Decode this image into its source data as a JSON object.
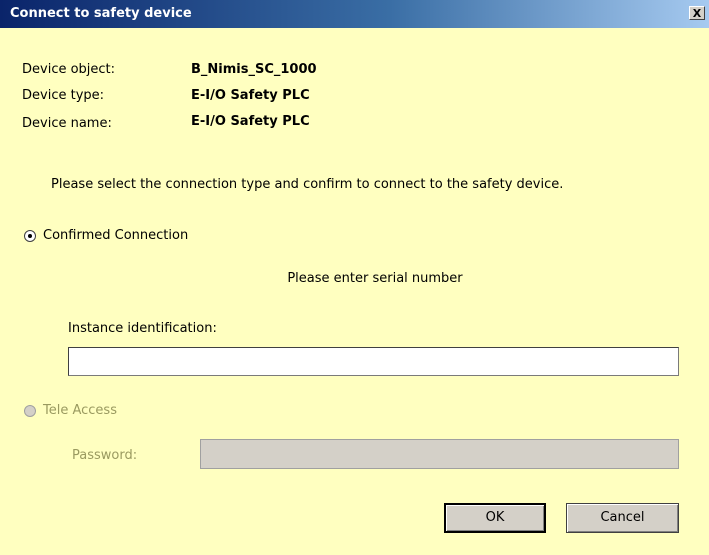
{
  "window": {
    "title": "Connect to safety device",
    "close_label": "X"
  },
  "device_info": {
    "object_label": "Device object:",
    "object_value": "B_Nimis_SC_1000",
    "type_label": "Device type:",
    "type_value": "E-I/O Safety PLC",
    "name_label": "Device name:",
    "name_value": "E-I/O Safety PLC"
  },
  "instruction": "Please select the connection type and confirm to connect to the safety device.",
  "confirmed": {
    "label": "Confirmed Connection",
    "selected": true,
    "note": "Please enter serial number",
    "instance_label": "Instance identification:",
    "instance_value": ""
  },
  "tele_access": {
    "label": "Tele Access",
    "selected": false,
    "enabled": false,
    "password_label": "Password:",
    "password_value": ""
  },
  "buttons": {
    "ok": "OK",
    "cancel": "Cancel"
  },
  "colors": {
    "background": "#ffffc0",
    "title_start": "#0a246a",
    "title_end": "#a6caf0",
    "disabled_text": "#9a9a60"
  }
}
